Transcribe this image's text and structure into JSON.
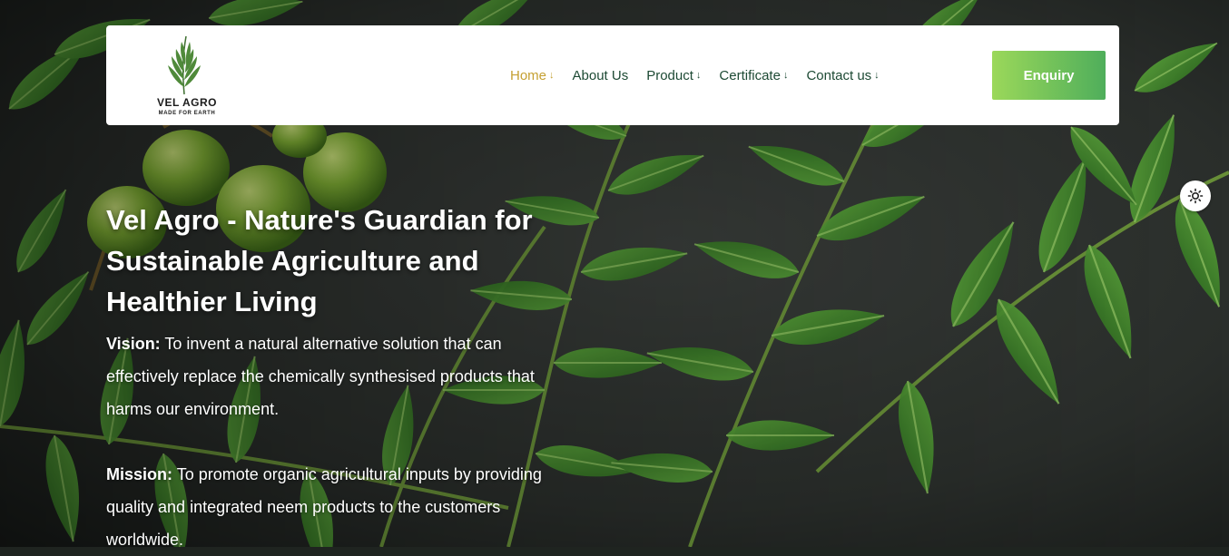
{
  "brand": {
    "name": "VEL AGRO",
    "tagline": "MADE FOR EARTH"
  },
  "nav": {
    "items": [
      {
        "label": "Home",
        "has_dropdown": true,
        "active": true
      },
      {
        "label": "About Us",
        "has_dropdown": false,
        "active": false
      },
      {
        "label": "Product",
        "has_dropdown": true,
        "active": false
      },
      {
        "label": "Certificate",
        "has_dropdown": true,
        "active": false
      },
      {
        "label": "Contact us",
        "has_dropdown": true,
        "active": false
      }
    ],
    "dropdown_glyph": "↓"
  },
  "header": {
    "enquiry_label": "Enquiry"
  },
  "hero": {
    "headline": "Vel Agro - Nature's Guardian for Sustainable Agriculture and Healthier Living",
    "vision_label": "Vision:",
    "vision_text": " To invent a natural alternative solution that can effectively replace the chemically synthesised products that harms our environment.",
    "mission_label": "Mission:",
    "mission_text": " To promote organic agricultural inputs by providing quality and integrated neem products to the customers worldwide."
  },
  "theme_toggle": {
    "icon": "sun-icon"
  },
  "colors": {
    "nav_text": "#1d4a34",
    "nav_active": "#c5a032",
    "enquiry_gradient_start": "#9bd85a",
    "enquiry_gradient_end": "#4fae5b"
  }
}
